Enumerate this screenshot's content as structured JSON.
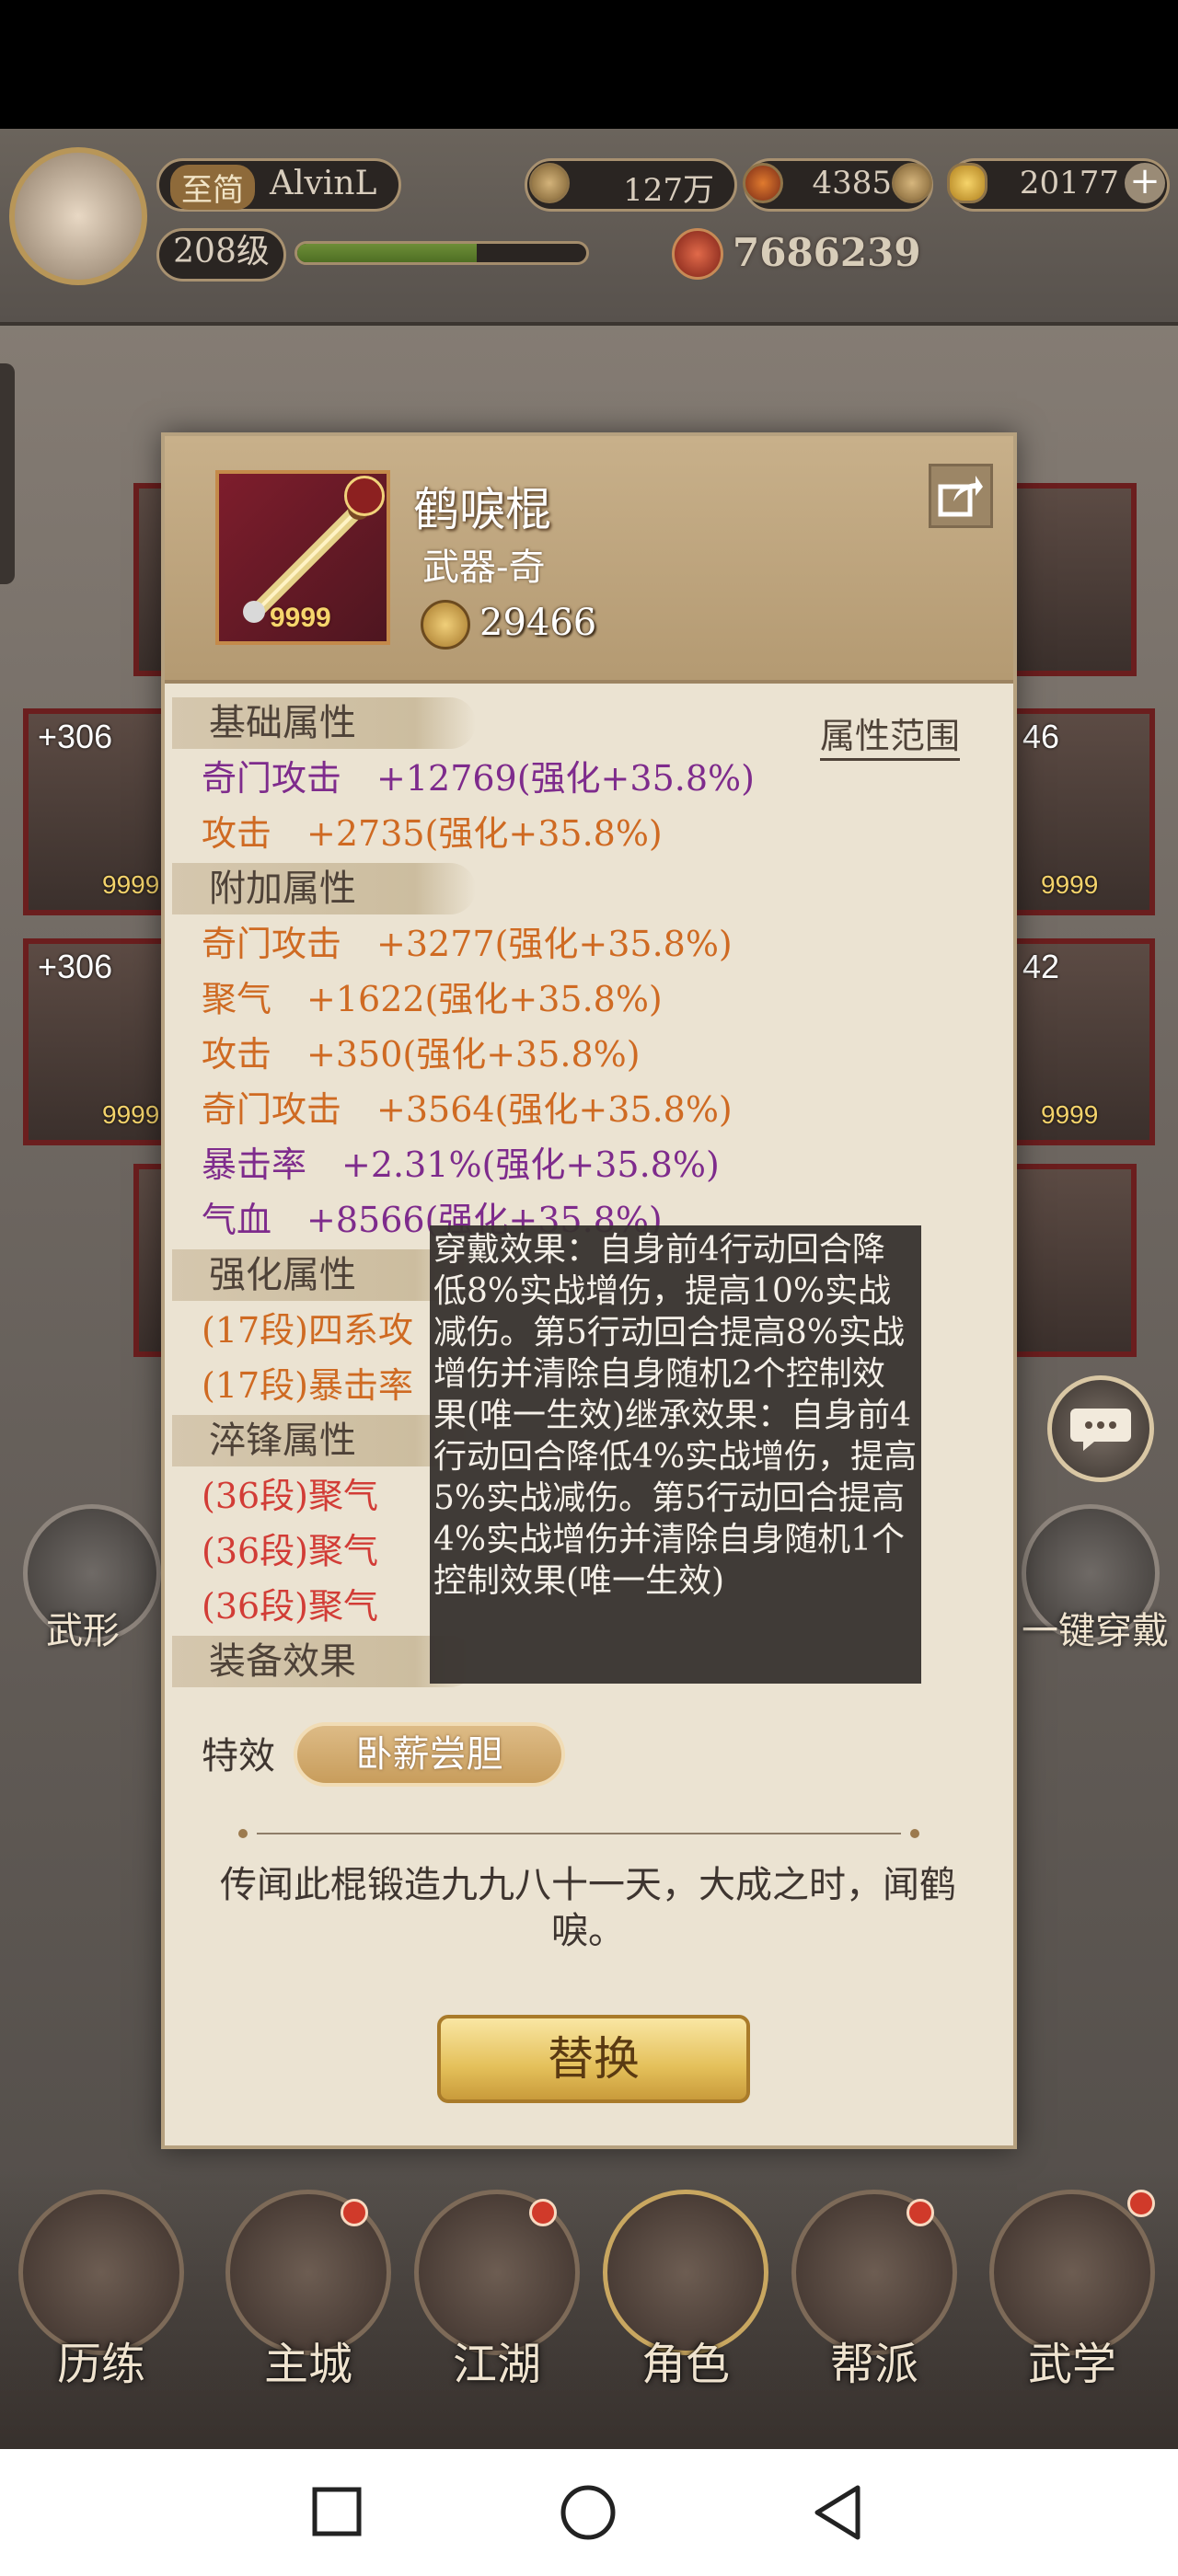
{
  "hud": {
    "vip_label": "至简",
    "player_name": "AlvinL",
    "level": "208级",
    "exp_fraction": 0.62,
    "coins": "127万",
    "stamina": "4385",
    "gold_ingots": "20177",
    "combat_power": "7686239"
  },
  "slots": {
    "left_top_plus": "+306",
    "left_mid_plus": "+306",
    "right_top_plus": "46",
    "right_mid_plus": "42",
    "count_label": "9999"
  },
  "side_buttons": {
    "left_label": "武形",
    "right_label": "一键穿戴"
  },
  "item": {
    "name": "鹤唳棍",
    "type": "武器-奇",
    "count": "9999",
    "power": "29466"
  },
  "attr_range_link": "属性范围",
  "sections": {
    "base": "基础属性",
    "extra": "附加属性",
    "enhance": "强化属性",
    "quench": "淬锋属性",
    "effect": "装备效果"
  },
  "base_attrs": [
    {
      "text": "奇门攻击　+12769(强化+35.8%)"
    },
    {
      "text": "攻击　+2735(强化+35.8%)"
    }
  ],
  "extra_attrs": [
    {
      "text": "奇门攻击　+3277(强化+35.8%)"
    },
    {
      "text": "聚气　+1622(强化+35.8%)"
    },
    {
      "text": "攻击　+350(强化+35.8%)"
    },
    {
      "text": "奇门攻击　+3564(强化+35.8%)"
    },
    {
      "text": "暴击率　+2.31%(强化+35.8%)"
    },
    {
      "text": "气血　+8566(强化+35.8%)"
    }
  ],
  "enhance_attrs": [
    {
      "text": "(17段)四系攻"
    },
    {
      "text": "(17段)暴击率"
    }
  ],
  "quench_attrs": [
    {
      "text": "(36段)聚气"
    },
    {
      "text": "(36段)聚气"
    },
    {
      "text": "(36段)聚气"
    }
  ],
  "tooltip": {
    "text": "穿戴效果：自身前4行动回合降低8%实战增伤，提高10%实战减伤。第5行动回合提高8%实战增伤并清除自身随机2个控制效果(唯一生效)继承效果：自身前4行动回合降低4%实战增伤，提高5%实战减伤。第5行动回合提高4%实战增伤并清除自身随机1个控制效果(唯一生效)"
  },
  "special": {
    "label": "特效",
    "tag": "卧薪尝胆"
  },
  "description": "传闻此棍锻造九九八十一天，大成之时，闻鹤唳。",
  "replace_button": "替换",
  "bottom_nav": [
    {
      "label": "历练"
    },
    {
      "label": "主城"
    },
    {
      "label": "江湖"
    },
    {
      "label": "角色"
    },
    {
      "label": "帮派"
    },
    {
      "label": "武学"
    }
  ],
  "colors": {
    "purple_attr": "#7e2b8c",
    "orange_attr": "#cf6a22",
    "red_attr": "#d23c36"
  }
}
